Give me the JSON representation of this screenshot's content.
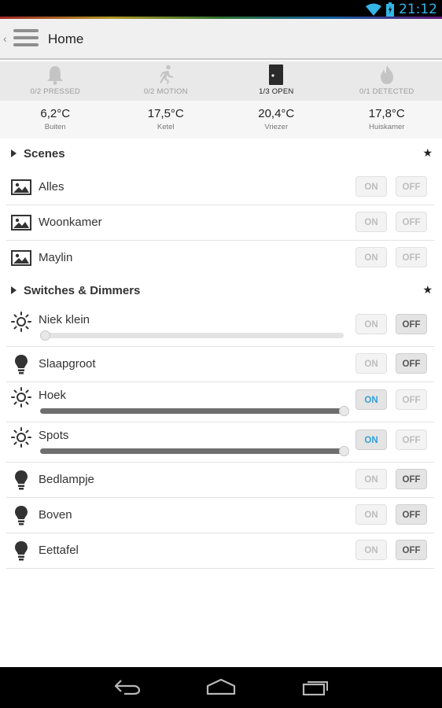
{
  "status_bar": {
    "time": "21:12",
    "icons": [
      "wifi-icon",
      "battery-icon"
    ]
  },
  "action_bar": {
    "title": "Home"
  },
  "sensors": [
    {
      "label": "0/2 PRESSED",
      "icon": "bell-icon",
      "active": false
    },
    {
      "label": "0/2 MOTION",
      "icon": "running-person-icon",
      "active": false
    },
    {
      "label": "1/3 OPEN",
      "icon": "door-icon",
      "active": true
    },
    {
      "label": "0/1 DETECTED",
      "icon": "flame-icon",
      "active": false
    }
  ],
  "temperatures": [
    {
      "value": "6,2°C",
      "label": "Buiten"
    },
    {
      "value": "17,5°C",
      "label": "Ketel"
    },
    {
      "value": "20,4°C",
      "label": "Vriezer"
    },
    {
      "value": "17,8°C",
      "label": "Huiskamer"
    }
  ],
  "scenes": {
    "title": "Scenes",
    "star": "★",
    "on_label": "ON",
    "off_label": "OFF",
    "items": [
      {
        "name": "Alles"
      },
      {
        "name": "Woonkamer"
      },
      {
        "name": "Maylin"
      }
    ]
  },
  "switches": {
    "title": "Switches & Dimmers",
    "star": "★",
    "on_label": "ON",
    "off_label": "OFF",
    "items": [
      {
        "name": "Niek klein",
        "type": "dimmer",
        "state": "off",
        "level": 0
      },
      {
        "name": "Slaapgroot",
        "type": "switch",
        "state": "off"
      },
      {
        "name": "Hoek",
        "type": "dimmer",
        "state": "on",
        "level": 100
      },
      {
        "name": "Spots",
        "type": "dimmer",
        "state": "on",
        "level": 100
      },
      {
        "name": "Bedlampje",
        "type": "switch",
        "state": "off"
      },
      {
        "name": "Boven",
        "type": "switch",
        "state": "off"
      },
      {
        "name": "Eettafel",
        "type": "switch",
        "state": "off"
      }
    ]
  },
  "colors": {
    "accent": "#33b5e5",
    "on_active": "#33a0d8"
  }
}
